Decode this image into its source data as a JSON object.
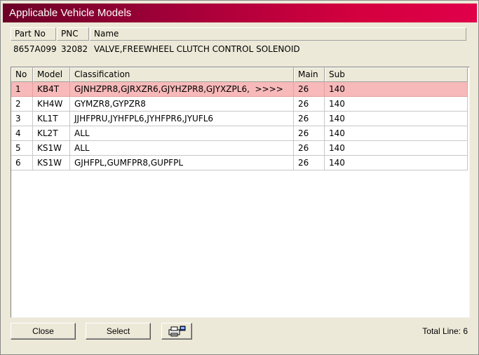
{
  "window": {
    "title": "Applicable Vehicle Models"
  },
  "part": {
    "headers": {
      "part_no": "Part No",
      "pnc": "PNC",
      "name": "Name"
    },
    "values": {
      "part_no": "8657A099",
      "pnc": "32082",
      "name": "VALVE,FREEWHEEL CLUTCH CONTROL SOLENOID"
    }
  },
  "grid": {
    "columns": {
      "no": "No",
      "model": "Model",
      "classification": "Classification",
      "main": "Main",
      "sub": "Sub"
    },
    "selected_index": 0,
    "rows": [
      {
        "no": "1",
        "model": "KB4T",
        "classification": "GJNHZPR8,GJRXZR6,GJYHZPR8,GJYXZPL6,",
        "more": ">>>>",
        "main": "26",
        "sub": "140"
      },
      {
        "no": "2",
        "model": "KH4W",
        "classification": "GYMZR8,GYPZR8",
        "more": "",
        "main": "26",
        "sub": "140"
      },
      {
        "no": "3",
        "model": "KL1T",
        "classification": "JJHFPRU,JYHFPL6,JYHFPR6,JYUFL6",
        "more": "",
        "main": "26",
        "sub": "140"
      },
      {
        "no": "4",
        "model": "KL2T",
        "classification": "ALL",
        "more": "",
        "main": "26",
        "sub": "140"
      },
      {
        "no": "5",
        "model": "KS1W",
        "classification": "ALL",
        "more": "",
        "main": "26",
        "sub": "140"
      },
      {
        "no": "6",
        "model": "KS1W",
        "classification": "GJHFPL,GUMFPR8,GUPFPL",
        "more": "",
        "main": "26",
        "sub": "140"
      }
    ]
  },
  "footer": {
    "close_label": "Close",
    "select_label": "Select",
    "print_icon": "printer-icon",
    "total_line": "Total Line: 6"
  }
}
